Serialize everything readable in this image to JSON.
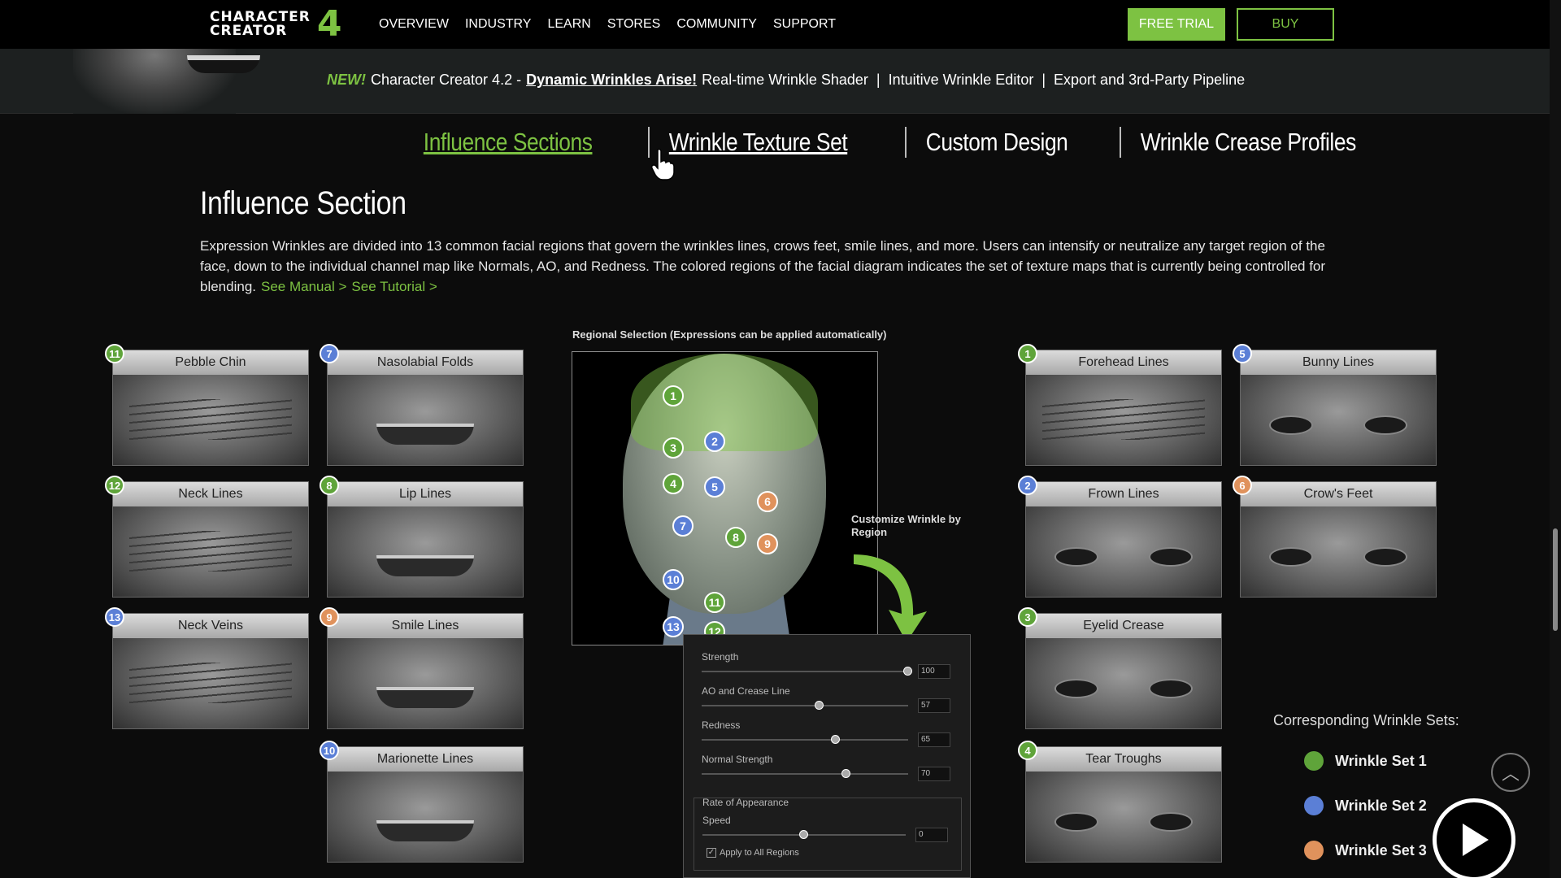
{
  "nav": {
    "logo_line1": "CHARACTER",
    "logo_line2": "CREATOR",
    "logo_digit": "4",
    "items": [
      "OVERVIEW",
      "INDUSTRY",
      "LEARN",
      "STORES",
      "COMMUNITY",
      "SUPPORT"
    ],
    "free_trial": "FREE TRIAL",
    "buy": "BUY"
  },
  "banner": {
    "new": "NEW!",
    "prefix": "Character Creator 4.2 -",
    "link": "Dynamic Wrinkles Arise!",
    "rest": "Real-time Wrinkle Shader  |  Intuitive Wrinkle Editor  |  Export and 3rd-Party Pipeline"
  },
  "tabs": [
    "Influence Sections",
    "Wrinkle Texture Set",
    "Custom Design",
    "Wrinkle Crease Profiles"
  ],
  "section": {
    "title": "Influence Section",
    "desc": "Expression Wrinkles are divided into 13 common facial regions that govern the wrinkles lines, crows feet, smile lines, and more. Users can intensify or neutralize any target region of the face, down to the individual channel map like Normals, AO, and Redness. The colored regions of the facial diagram indicates the set of texture maps that is currently being controlled for blending.",
    "link_manual": "See Manual >",
    "link_tutorial": "See Tutorial >"
  },
  "cards_left": [
    {
      "num": "11",
      "label": "Pebble Chin",
      "color": "g"
    },
    {
      "num": "7",
      "label": "Nasolabial Folds",
      "color": "b"
    },
    {
      "num": "12",
      "label": "Neck Lines",
      "color": "g"
    },
    {
      "num": "8",
      "label": "Lip Lines",
      "color": "g"
    },
    {
      "num": "13",
      "label": "Neck Veins",
      "color": "b"
    },
    {
      "num": "9",
      "label": "Smile Lines",
      "color": "o"
    },
    {
      "num": "10",
      "label": "Marionette Lines",
      "color": "b"
    }
  ],
  "cards_right": [
    {
      "num": "1",
      "label": "Forehead Lines",
      "color": "g"
    },
    {
      "num": "5",
      "label": "Bunny Lines",
      "color": "b"
    },
    {
      "num": "2",
      "label": "Frown Lines",
      "color": "b"
    },
    {
      "num": "6",
      "label": "Crow's Feet",
      "color": "o"
    },
    {
      "num": "3",
      "label": "Eyelid Crease",
      "color": "g"
    },
    {
      "num": "4",
      "label": "Tear Troughs",
      "color": "g"
    }
  ],
  "diagram": {
    "label": "Regional Selection (Expressions can be applied automatically)",
    "points": [
      "1",
      "2",
      "3",
      "4",
      "5",
      "6",
      "7",
      "8",
      "9",
      "10",
      "11",
      "12",
      "13"
    ],
    "customize": "Customize Wrinkle by Region"
  },
  "panel": {
    "sliders": [
      {
        "label": "Strength",
        "value": "100",
        "level": 1.0
      },
      {
        "label": "AO and Crease Line",
        "value": "57",
        "level": 0.57
      },
      {
        "label": "Redness",
        "value": "65",
        "level": 0.65
      },
      {
        "label": "Normal Strength",
        "value": "70",
        "level": 0.7
      }
    ],
    "rate_title": "Rate of Appearance",
    "speed_label": "Speed",
    "speed_value": "0",
    "speed_level": 0.5,
    "apply_all": "Apply to All Regions"
  },
  "legend": {
    "title": "Corresponding Wrinkle Sets:",
    "items": [
      {
        "label": "Wrinkle Set 1",
        "color": "#5fa43a"
      },
      {
        "label": "Wrinkle Set 2",
        "color": "#5b7fd6"
      },
      {
        "label": "Wrinkle Set 3",
        "color": "#e0925c"
      }
    ]
  },
  "colors": {
    "accent": "#7dc242",
    "set1": "#5fa43a",
    "set2": "#5b7fd6",
    "set3": "#e0925c"
  }
}
